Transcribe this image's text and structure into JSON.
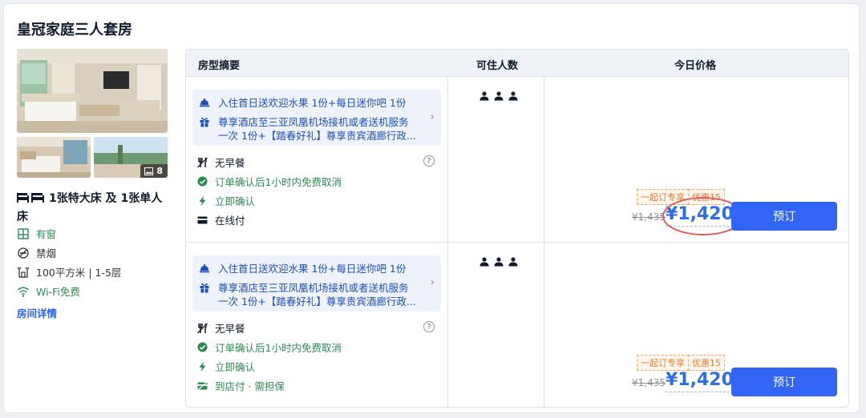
{
  "room": {
    "title": "皇冠家庭三人套房",
    "photo_count": "8",
    "bed": "1张特大床 及 1张单人床",
    "features": {
      "window": "有窗",
      "smoking": "禁烟",
      "area": "100平方米 | 1-5层",
      "wifi": "Wi-Fi免费"
    },
    "detail_link": "房间详情"
  },
  "table": {
    "headers": {
      "summary": "房型摘要",
      "guests": "可住人数",
      "price": "今日价格"
    },
    "rows": [
      {
        "offer_line1": "入住首日送欢迎水果 1份+每日迷你吧 1份",
        "offer_line2": "尊享酒店至三亚凤凰机场接机或者送机服务",
        "offer_line3": "一次 1份+【踏春好礼】尊享贵宾酒廊行政...",
        "breakfast": "无早餐",
        "cancel": "订单确认后1小时内免费取消",
        "confirm": "立即确认",
        "payment": "在线付",
        "promo_a": "一起订专享",
        "promo_b": "优惠15",
        "original_price": "¥1,435",
        "price": "¥1,420",
        "book": "预订",
        "guests": 3
      },
      {
        "offer_line1": "入住首日送欢迎水果 1份+每日迷你吧 1份",
        "offer_line2": "尊享酒店至三亚凤凰机场接机或者送机服务",
        "offer_line3": "一次 1份+【踏春好礼】尊享贵宾酒廊行政...",
        "breakfast": "无早餐",
        "cancel": "订单确认后1小时内免费取消",
        "confirm": "立即确认",
        "payment": "到店付 · 需担保",
        "promo_a": "一起订专享",
        "promo_b": "优惠15",
        "original_price": "¥1,435",
        "price": "¥1,420",
        "book": "预订",
        "guests": 3
      }
    ]
  },
  "colors": {
    "accent": "#3264f5",
    "price": "#2f6ee5",
    "green": "#2e8b4f",
    "promo": "#ec7a23",
    "annotation": "#e05c5c"
  },
  "icons": [
    "bed-icon",
    "window-icon",
    "no-smoking-icon",
    "area-icon",
    "wifi-icon",
    "service-bell-icon",
    "gift-icon",
    "chevron-right-icon",
    "no-breakfast-icon",
    "check-circle-icon",
    "lightning-icon",
    "card-icon",
    "pay-at-hotel-icon",
    "help-icon",
    "person-icon",
    "image-icon"
  ]
}
